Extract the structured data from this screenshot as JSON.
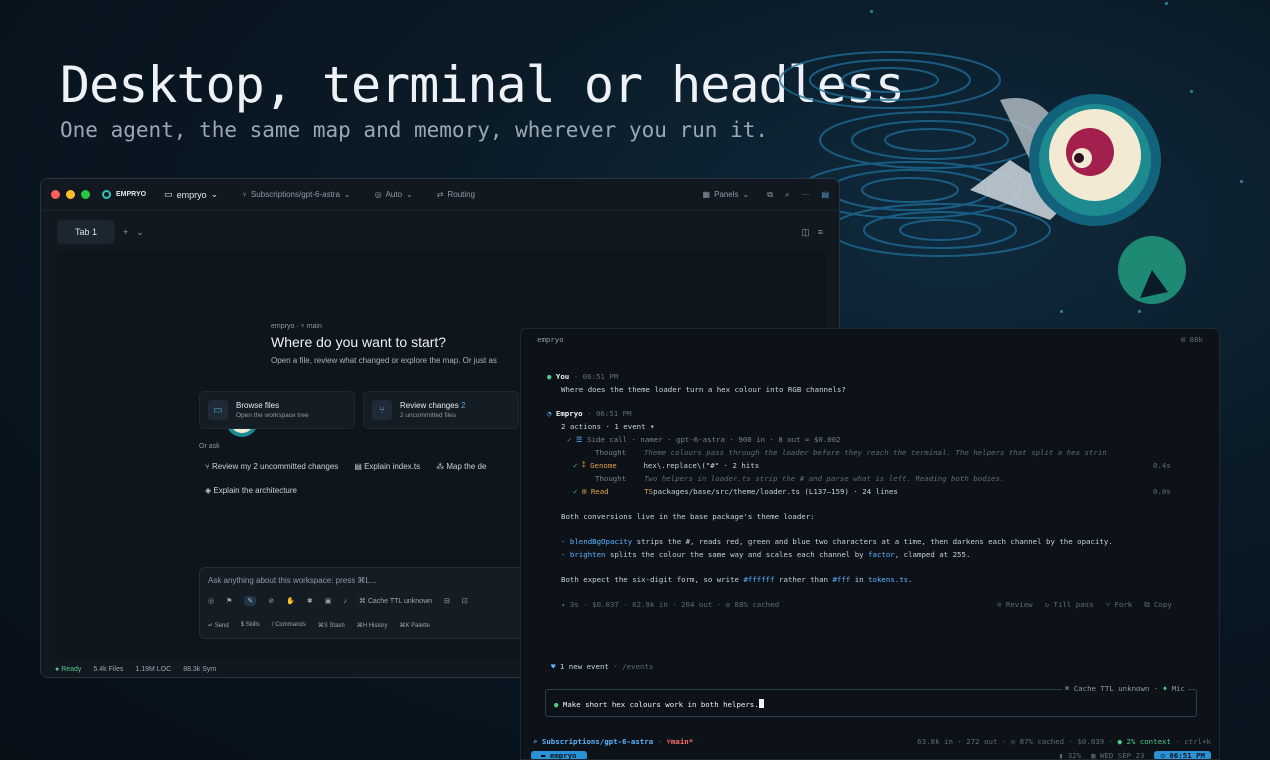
{
  "hero": {
    "title": "Desktop, terminal or headless",
    "subtitle": "One agent, the same map and memory, wherever you run it."
  },
  "desktop": {
    "brand": "EMPRYO",
    "workspace": "empryo",
    "subscription": "Subscriptions/gpt-6-astra",
    "mode": "Auto",
    "routing": "Routing",
    "panels": "Panels",
    "tab": "Tab 1",
    "crumb": "empryo · ⑂ main",
    "heading": "Where do you want to start?",
    "intro": "Open a file, review what changed or explore the map. Or just as",
    "cards": [
      {
        "title": "Browse files",
        "badge": "",
        "sub": "Open the workspace tree"
      },
      {
        "title": "Review changes",
        "badge": "2",
        "sub": "2 uncommitted files"
      }
    ],
    "or_ask": "Or ask",
    "suggestions": [
      "Review my 2 uncommitted changes",
      "Explain index.ts",
      "Map the de",
      "Explain the architecture"
    ],
    "composer_placeholder": "Ask anything about this workspace: press ⌘L...",
    "cache": "Cache TTL unknown",
    "keys": [
      "↵ Send",
      "$ Skills",
      "/ Commands",
      "⌘S Stash",
      "⌘H History",
      "⌘K Palette"
    ],
    "status": {
      "ready": "Ready",
      "files": "5.4k Files",
      "loc": "1.19M LOC",
      "sym": "88.3k Sym"
    }
  },
  "terminal": {
    "title": "empryo",
    "tokens": "88k",
    "you": "You",
    "you_time": "06:51 PM",
    "question": "Where does the theme loader turn a hex colour into RGB channels?",
    "agent": "Empryo",
    "agent_time": "06:51 PM",
    "actions": "2 actions · 1 event ▾",
    "side_call": "Side call · namer · gpt-6-astra · 900 in · 8 out ≈ $0.002",
    "thought1_label": "Thought",
    "thought1": "Theme colours pass through the loader before they reach the terminal. The helpers that split a hex strin",
    "genome_label": "Genome",
    "genome": "hex\\.replace\\(\"#\"  · 2 hits",
    "genome_time": "0.4s",
    "thought2_label": "Thought",
    "thought2": "Two helpers in loader.ts strip the # and parse what is left. Reading both bodies.",
    "read_label": "Read",
    "read": "packages/base/src/theme/loader.ts (L137–159) · 24 lines",
    "read_time": "0.0s",
    "answer_intro": "Both conversions live in the base package's theme loader:",
    "bullet1_fn": "blendBgOpacity",
    "bullet1": " strips the #, reads red, green and blue two characters at a time, then darkens each channel by the opacity.",
    "bullet2_fn": "brighten",
    "bullet2": " splits the colour the same way and scales each channel by ",
    "bullet2_arg": "factor",
    "bullet2_end": ", clamped at 255.",
    "closing_a": "Both expect the six-digit form, so write ",
    "closing_b": "#ffffff",
    "closing_c": " rather than ",
    "closing_d": "#fff",
    "closing_e": " in ",
    "closing_f": "tokens.ts",
    "closing_g": ".",
    "stats": "✦ 3s · $0.037 · 62.9k in · 264 out · ◎ 88% cached",
    "actions_right": [
      "⊙ Review",
      "↻ Till pass",
      "⑂ Fork",
      "⧉ Copy"
    ],
    "event": "1 new event",
    "event_cmd": "/events",
    "prompt": "Make short hex colours work in both helpers.",
    "prompt_cache": "⌘ Cache TTL unknown",
    "prompt_mic": "Mic",
    "footer_left_sub": "Subscriptions/gpt-6-astra",
    "footer_left_branch": "⑂main*",
    "footer_right": "63.8k in · 272 out · ◎ 87% cached · $0.039 ·",
    "footer_context": "2% context",
    "footer_key": "· ctrl+k",
    "footer_dir": "empryo",
    "footer_bat": "32%",
    "footer_date": "WED SEP 23",
    "footer_time": "06:51 PM"
  }
}
